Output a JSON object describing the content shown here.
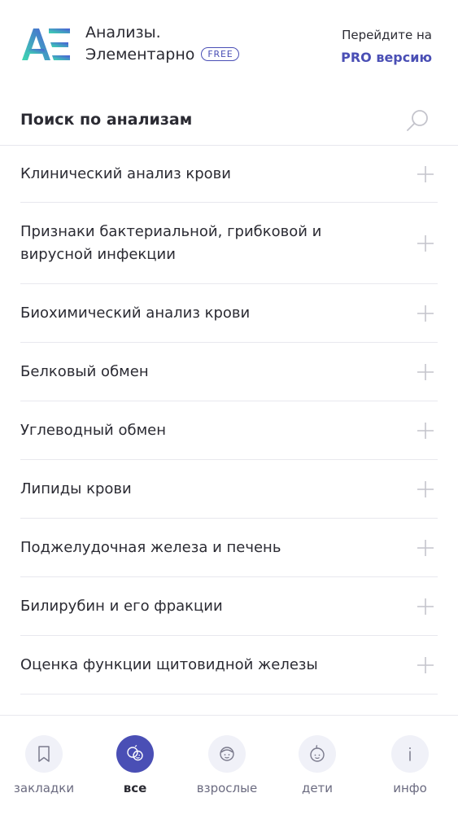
{
  "header": {
    "title_line1": "Анализы.",
    "title_line2": "Элементарно",
    "badge": "FREE",
    "pro_line1": "Перейдите на",
    "pro_line2": "PRO версию"
  },
  "search": {
    "title": "Поиск по анализам"
  },
  "list": {
    "items": [
      {
        "label": "Клинический анализ крови"
      },
      {
        "label": "Признаки бактериальной, грибковой и вирусной инфекции"
      },
      {
        "label": "Биохимический анализ крови"
      },
      {
        "label": "Белковый обмен"
      },
      {
        "label": "Углеводный обмен"
      },
      {
        "label": "Липиды крови"
      },
      {
        "label": "Поджелудочная железа и печень"
      },
      {
        "label": "Билирубин и его фракции"
      },
      {
        "label": "Оценка функции щитовидной железы"
      },
      {
        "label": ""
      }
    ]
  },
  "tabbar": {
    "active": "all",
    "tabs": [
      {
        "id": "bookmarks",
        "label": "закладки",
        "icon": "bookmark-icon"
      },
      {
        "id": "all",
        "label": "все",
        "icon": "family-icon"
      },
      {
        "id": "adults",
        "label": "взрослые",
        "icon": "adult-face-icon"
      },
      {
        "id": "kids",
        "label": "дети",
        "icon": "child-face-icon"
      },
      {
        "id": "info",
        "label": "инфо",
        "icon": "info-icon"
      }
    ]
  },
  "colors": {
    "accent": "#4a4fb5",
    "text": "#2b2b33",
    "muted": "#6b6b80",
    "divider": "#e8e8ee",
    "logo_gradient_start": "#3dd9b0",
    "logo_gradient_end": "#4a5cd6"
  }
}
